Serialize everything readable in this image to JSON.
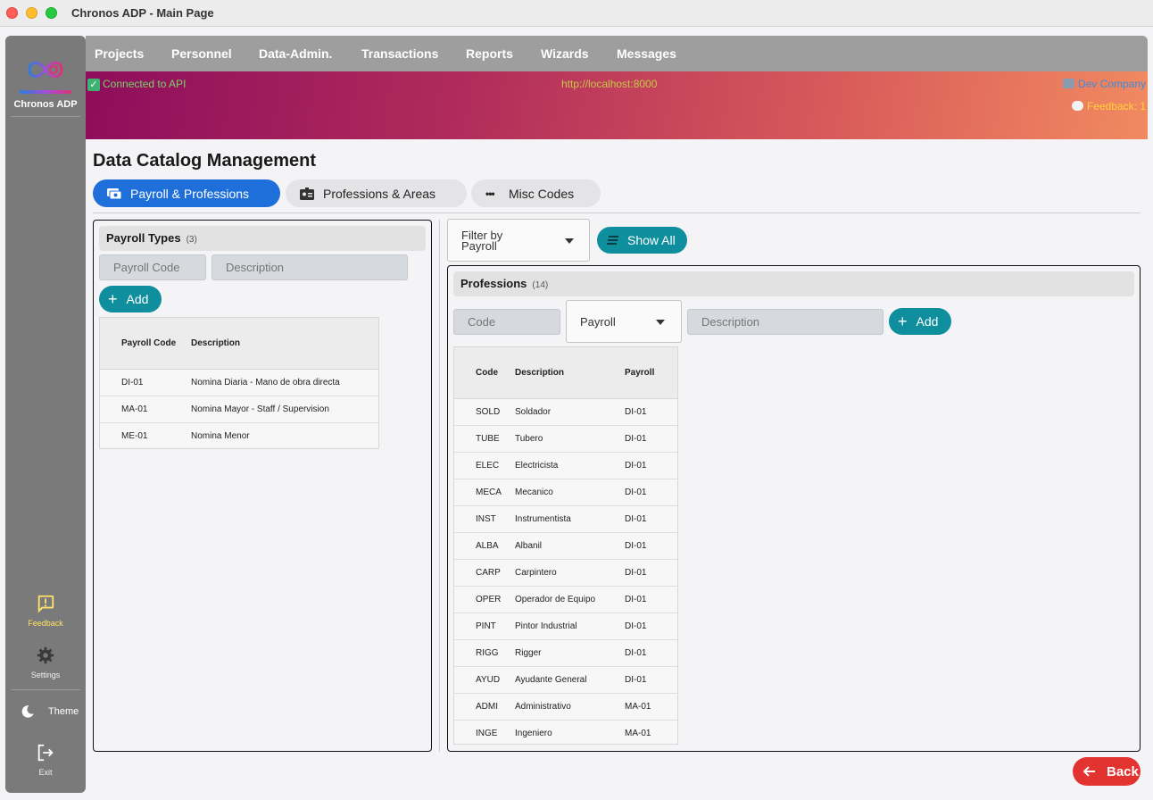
{
  "window": {
    "title": "Chronos ADP - Main Page"
  },
  "sidebar": {
    "brand": "Chronos ADP",
    "feedback_label": "Feedback",
    "settings_label": "Settings",
    "theme_label": "Theme",
    "exit_label": "Exit"
  },
  "menu": {
    "items": [
      "Projects",
      "Personnel",
      "Data-Admin.",
      "Transactions",
      "Reports",
      "Wizards",
      "Messages"
    ]
  },
  "banner": {
    "connection": "Connected to API",
    "url": "http://localhost:8000",
    "company": "Dev Company",
    "feedback": "Feedback: 1"
  },
  "page": {
    "title": "Data Catalog Management",
    "tabs": [
      "Payroll & Professions",
      "Professions & Areas",
      "Misc Codes"
    ]
  },
  "payroll_types": {
    "title": "Payroll Types",
    "count": "(3)",
    "code_placeholder": "Payroll Code",
    "description_placeholder": "Description",
    "add_label": "Add",
    "columns": [
      "Payroll Code",
      "Description"
    ],
    "rows": [
      [
        "DI-01",
        "Nomina Diaria - Mano de obra directa"
      ],
      [
        "MA-01",
        "Nomina Mayor - Staff / Supervision"
      ],
      [
        "ME-01",
        "Nomina Menor"
      ]
    ]
  },
  "filter": {
    "label": "Filter by Payroll",
    "show_all": "Show All"
  },
  "professions": {
    "title": "Professions",
    "count": "(14)",
    "code_placeholder": "Code",
    "payroll_select": "Payroll",
    "description_placeholder": "Description",
    "add_label": "Add",
    "columns": [
      "Code",
      "Description",
      "Payroll"
    ],
    "rows": [
      [
        "SOLD",
        "Soldador",
        "DI-01"
      ],
      [
        "TUBE",
        "Tubero",
        "DI-01"
      ],
      [
        "ELEC",
        "Electricista",
        "DI-01"
      ],
      [
        "MECA",
        "Mecanico",
        "DI-01"
      ],
      [
        "INST",
        "Instrumentista",
        "DI-01"
      ],
      [
        "ALBA",
        "Albanil",
        "DI-01"
      ],
      [
        "CARP",
        "Carpintero",
        "DI-01"
      ],
      [
        "OPER",
        "Operador de Equipo",
        "DI-01"
      ],
      [
        "PINT",
        "Pintor Industrial",
        "DI-01"
      ],
      [
        "RIGG",
        "Rigger",
        "DI-01"
      ],
      [
        "AYUD",
        "Ayudante General",
        "DI-01"
      ],
      [
        "ADMI",
        "Administrativo",
        "MA-01"
      ],
      [
        "INGE",
        "Ingeniero",
        "MA-01"
      ]
    ]
  },
  "footer": {
    "back_label": "Back"
  },
  "colors": {
    "primary": "#1e6fd9",
    "teal": "#0f8e9e",
    "danger": "#e23330",
    "sidebar": "#7a7a7a"
  }
}
